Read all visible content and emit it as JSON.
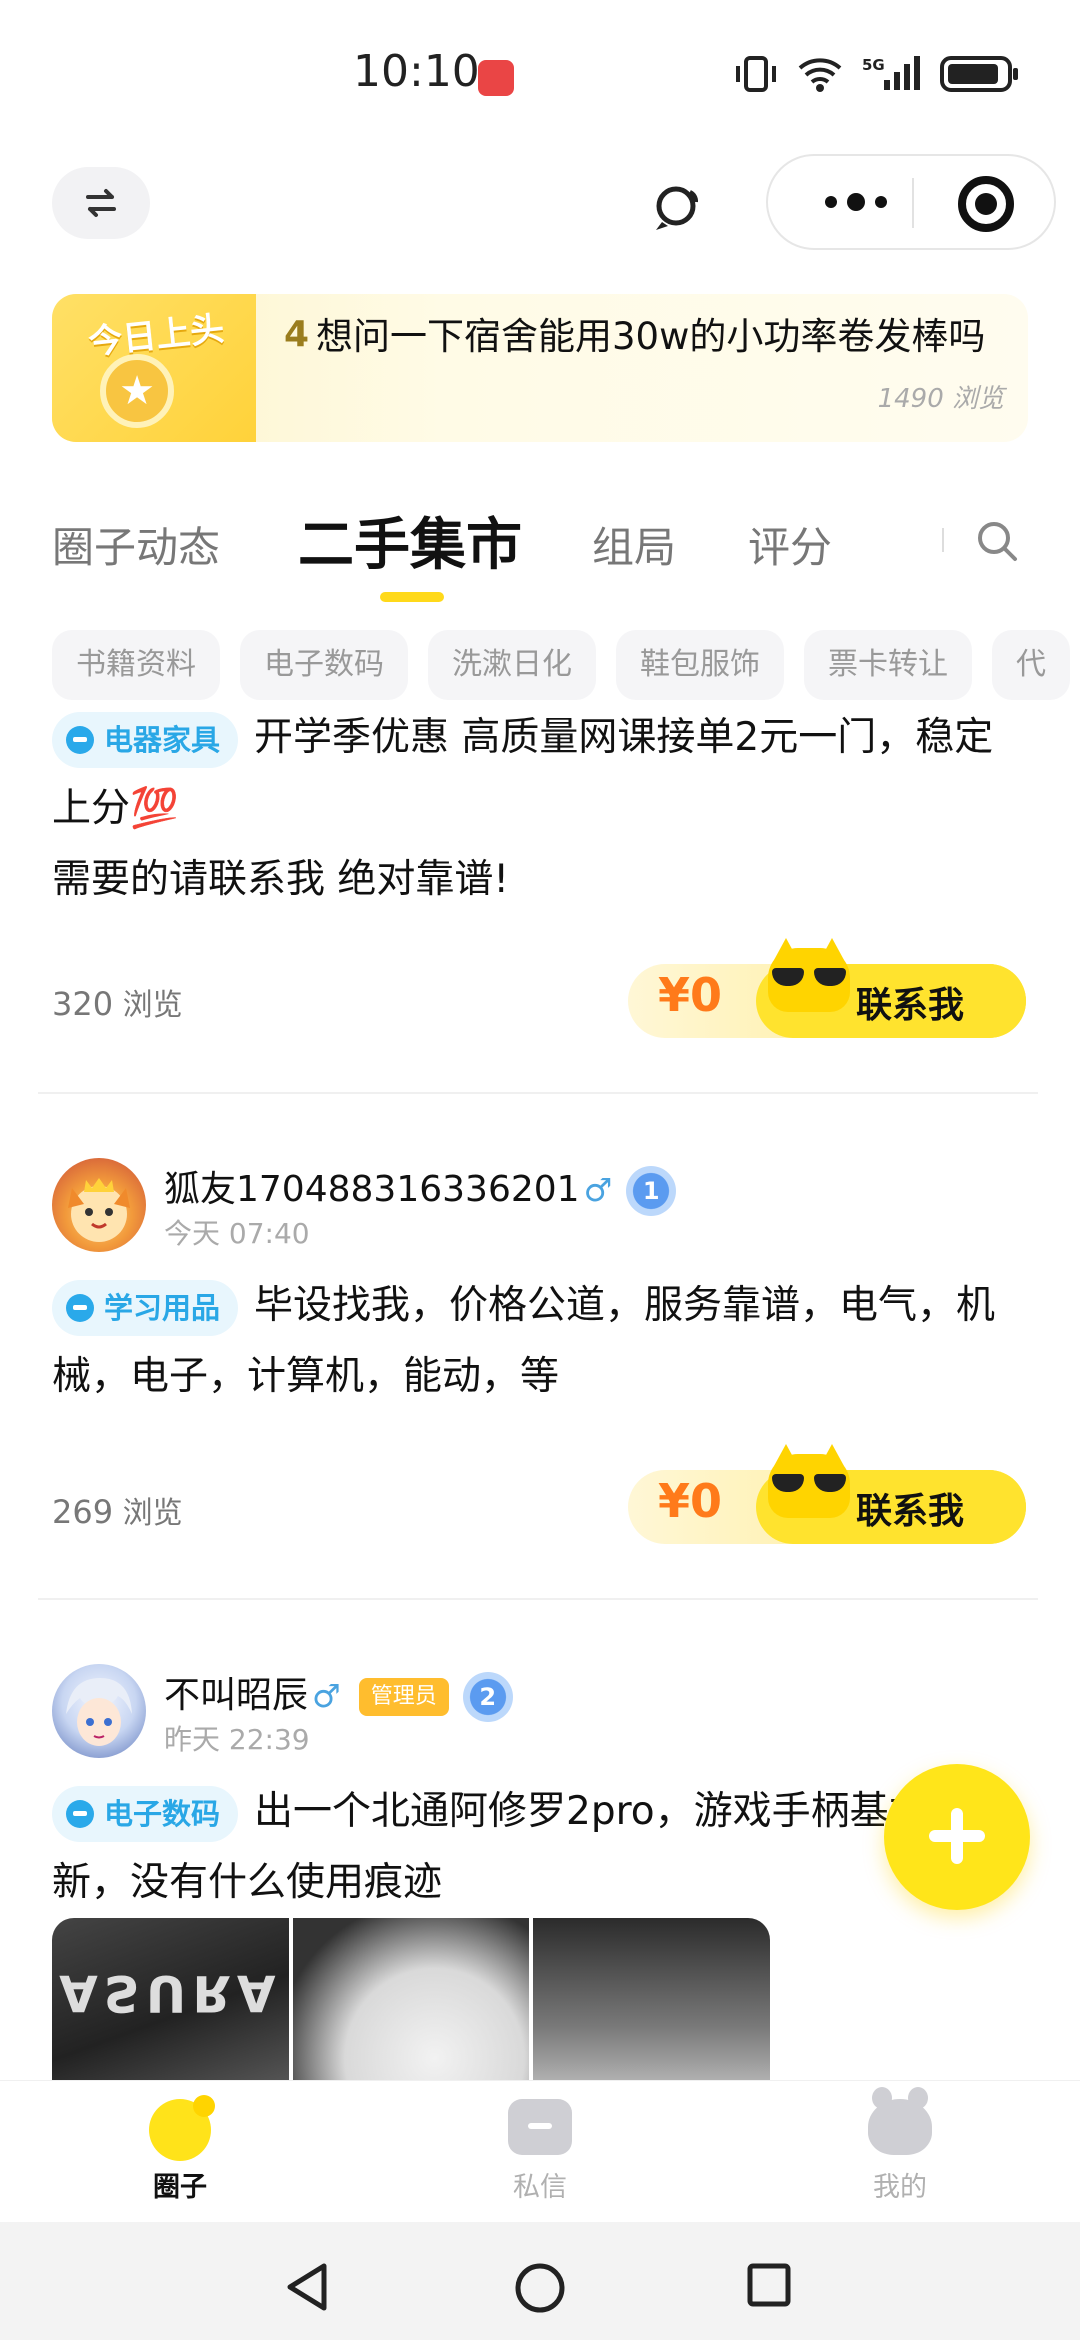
{
  "status_bar": {
    "time": "10:10",
    "network": "5G"
  },
  "top_nav": {
    "switch_icon": "swap-arrows-icon",
    "chat_icon": "chat-bubble-icon",
    "more_icon": "more-dots-icon",
    "close_icon": "target-icon"
  },
  "headline": {
    "badge": "今日上头",
    "rank": "4",
    "text": "想问一下宿舍能用30w的小功率卷发棒吗",
    "views": "1490 浏览"
  },
  "tabs": [
    {
      "label": "圈子动态"
    },
    {
      "label": "二手集市",
      "active": true
    },
    {
      "label": "组局"
    },
    {
      "label": "评分"
    }
  ],
  "chips": [
    "书籍资料",
    "电子数码",
    "洗漱日化",
    "鞋包服饰",
    "票卡转让",
    "代"
  ],
  "posts": [
    {
      "tag": "电器家具",
      "body": "开学季优惠 高质量网课接单2元一门，稳定上分💯\n需要的请联系我 绝对靠谱!",
      "views_count": "320",
      "views_label": "浏览",
      "price": "¥0",
      "contact": "联系我"
    },
    {
      "user": "狐友170488316336201",
      "gender": "♂",
      "level": "1",
      "time": "今天 07:40",
      "tag": "学习用品",
      "body": "毕设找我，价格公道，服务靠谱，电气，机械，电子，计算机，能动，等",
      "views_count": "269",
      "views_label": "浏览",
      "price": "¥0",
      "contact": "联系我"
    },
    {
      "user": "不叫昭辰",
      "gender": "♂",
      "badge": "管理员",
      "level": "2",
      "time": "昨天 22:39",
      "tag": "电子数码",
      "body": "出一个北通阿修罗2pro，游戏手柄基本全新，没有什么使用痕迹",
      "thumb_text": "ASURA"
    }
  ],
  "fab": {
    "icon": "plus-icon"
  },
  "bottom_tabs": [
    {
      "label": "圈子",
      "active": true
    },
    {
      "label": "私信"
    },
    {
      "label": "我的"
    }
  ],
  "colors": {
    "accent": "#FFE31A",
    "price": "#FF7A1A",
    "tag_blue": "#29A7E6"
  }
}
